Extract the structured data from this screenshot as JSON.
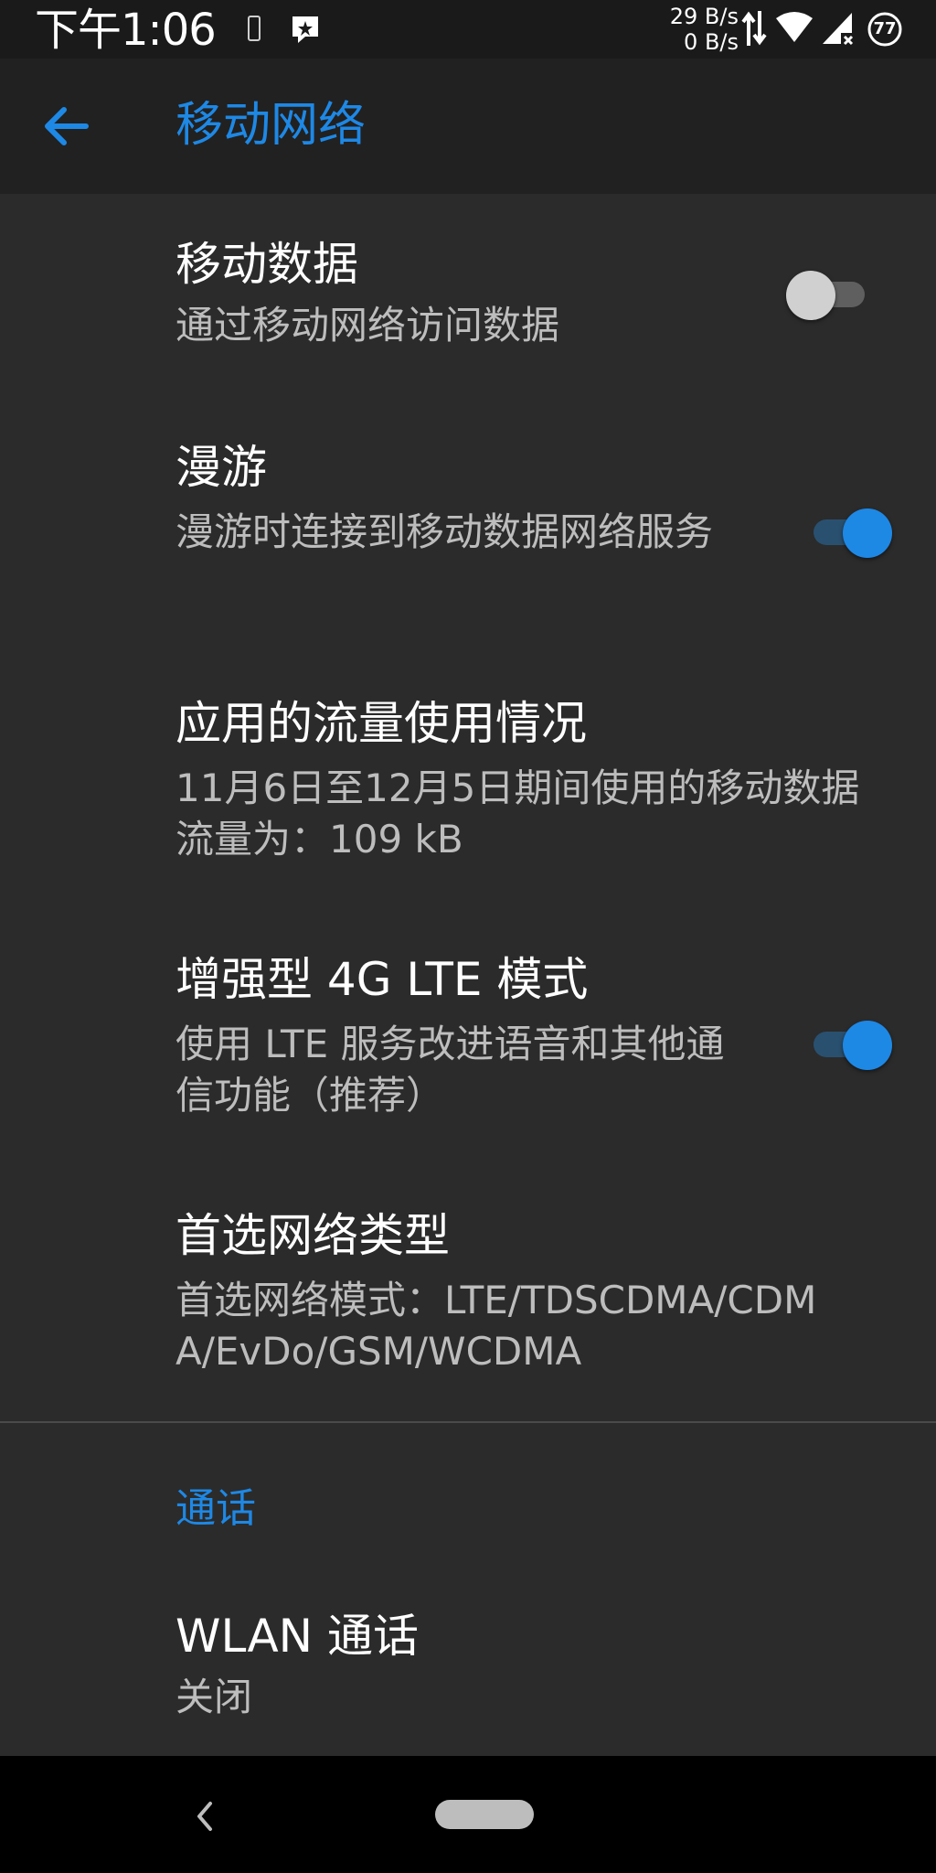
{
  "status_bar": {
    "time": "下午1:06",
    "net_up": "29 B/s",
    "net_down": "0 B/s",
    "battery_level": "77",
    "icons": [
      "phone-icon",
      "app-notification-icon",
      "data-arrows-icon",
      "wifi-icon",
      "cell-signal-no-service-icon",
      "battery-saver-icon"
    ]
  },
  "app_bar": {
    "title": "移动网络",
    "back_icon": "arrow-left-icon"
  },
  "preferences": [
    {
      "title": "移动数据",
      "summary": "通过移动网络访问数据",
      "switch": false
    },
    {
      "title": "漫游",
      "summary": "漫游时连接到移动数据网络服务",
      "switch": true
    },
    {
      "title": "应用的流量使用情况",
      "summary": "11月6日至12月5日期间使用的移动数据流量为：109 kB"
    },
    {
      "title": "增强型 4G LTE 模式",
      "summary": "使用 LTE 服务改进语音和其他通信功能（推荐）",
      "switch": true
    },
    {
      "title": "首选网络类型",
      "summary": "首选网络模式：LTE/TDSCDMA/CDMA/EvDo/GSM/WCDMA"
    }
  ],
  "calls_section": {
    "header": "通话",
    "item": {
      "title": "WLAN 通话",
      "summary": "关闭"
    }
  },
  "nav_bar": {
    "back_icon": "nav-back-icon",
    "home_icon": "home-pill-icon"
  },
  "colors": {
    "accent": "#1e88e5",
    "background": "#2b2b2b",
    "app_bar": "#212121",
    "status_bar": "#1a1a1a",
    "summary_text": "#bdbdbd"
  }
}
